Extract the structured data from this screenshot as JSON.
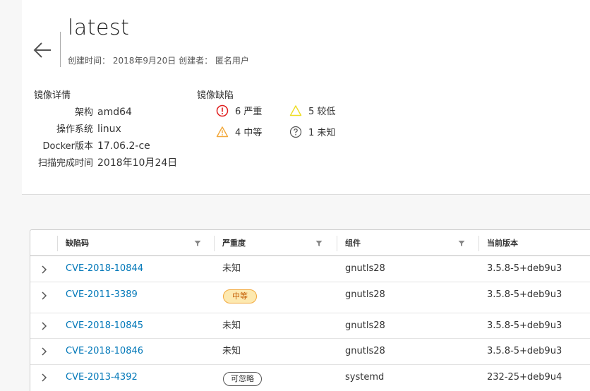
{
  "header": {
    "title": "latest",
    "meta": "创建时间： 2018年9月20日 创建者： 匿名用户"
  },
  "details": {
    "section_title": "镜像详情",
    "rows": [
      {
        "label": "架构",
        "value": "amd64"
      },
      {
        "label": "操作系统",
        "value": "linux"
      },
      {
        "label": "Docker版本",
        "value": "17.06.2-ce"
      },
      {
        "label": "扫描完成时间",
        "value": "2018年10月24日"
      }
    ]
  },
  "vulnerabilities": {
    "section_title": "镜像缺陷",
    "critical": "6 严重",
    "low": "5 较低",
    "medium": "4 中等",
    "unknown": "1 未知"
  },
  "colors": {
    "link": "#0077b8",
    "critical": "#e02020",
    "medium": "#f2a83b",
    "low": "#eedd22",
    "unknown": "#555555"
  },
  "table": {
    "columns": [
      "缺陷码",
      "严重度",
      "组件",
      "当前版本"
    ],
    "rows": [
      {
        "cve": "CVE-2018-10844",
        "severity": "未知",
        "component": "gnutls28",
        "version": "3.5.8-5+deb9u3"
      },
      {
        "cve": "CVE-2011-3389",
        "severity_badge": "中等",
        "component": "gnutls28",
        "version": "3.5.8-5+deb9u3"
      },
      {
        "cve": "CVE-2018-10845",
        "severity": "未知",
        "component": "gnutls28",
        "version": "3.5.8-5+deb9u3"
      },
      {
        "cve": "CVE-2018-10846",
        "severity": "未知",
        "component": "gnutls28",
        "version": "3.5.8-5+deb9u3"
      },
      {
        "cve": "CVE-2013-4392",
        "severity_badge": "可忽略",
        "component": "systemd",
        "version": "232-25+deb9u4"
      }
    ]
  }
}
